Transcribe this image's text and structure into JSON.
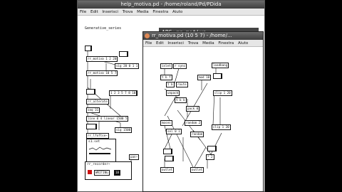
{
  "colors": {
    "desktop": "#000000",
    "titlebar": "#4a4a4a",
    "title_text": "#f2f2f2",
    "window_bg": "#ffffff",
    "menubar": "#e6e6e6",
    "record_red": "#cc1111"
  },
  "back_window": {
    "title": "help_motiva.pd - /home/roland/Pd/PDida",
    "menus": [
      "File",
      "Edit",
      "Inserisci",
      "Trova",
      "Media",
      "Finestra",
      "Aiuto"
    ],
    "comment": "Generative_series",
    "header": "ABS:rr_motiva",
    "objects": [
      "rr_motiva 1 2 20",
      "sig 20 0 1 1",
      "rr_motiva 10 5 7",
      "1 2 3 5 7 8 10",
      "rr_alterate",
      "seq 31",
      "line 0 4 linear 1500 5",
      "sig 1500",
      "rr_lfoftse~",
      "s1.set",
      "pan~",
      "seq 31",
      "rr_recorder~",
      "WRITING",
      "rec",
      "18"
    ]
  },
  "front_window": {
    "title": "rr_motiva.pd  (10 5 7) - /home/...",
    "menus": [
      "File",
      "Edit",
      "Inserisci",
      "Trova",
      "Media",
      "Finestra",
      "Aiuto"
    ],
    "objects": [
      "inlet",
      "r sync",
      "loadbang",
      "t b f",
      "mod 10",
      "t b",
      "route",
      "s",
      "clip 1 20",
      "unpack",
      "t b b",
      "pack 0",
      "moses",
      "random 2",
      "s",
      "sel 0 1",
      "random",
      "clip 1 20",
      "* 2",
      "s",
      "outlet",
      "outlet",
      "seed",
      "t f",
      "sel 1",
      "t b"
    ]
  }
}
